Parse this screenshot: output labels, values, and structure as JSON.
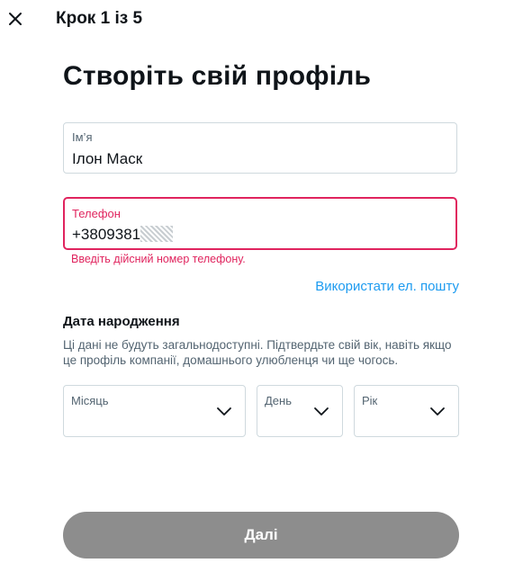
{
  "header": {
    "step_label": "Крок 1 із 5",
    "close_icon": "close-icon"
  },
  "page": {
    "title": "Створіть свій профіль"
  },
  "form": {
    "name": {
      "label": "Ім’я",
      "value": "Ілон Маск"
    },
    "phone": {
      "label": "Телефон",
      "value": "+3809381",
      "error": "Введіть дійсний номер телефону."
    },
    "use_email_link": "Використати ел. пошту"
  },
  "dob": {
    "title": "Дата народження",
    "description": "Ці дані не будуть загальнодоступні. Підтвердьте свій вік, навіть якщо це профіль компанії, домашнього улюбленця чи ще чогось.",
    "month_label": "Місяць",
    "day_label": "День",
    "year_label": "Рік"
  },
  "actions": {
    "next_label": "Далі"
  },
  "colors": {
    "error": "#e0245e",
    "link": "#1d9bf0",
    "button_disabled": "#8d8d8d"
  }
}
